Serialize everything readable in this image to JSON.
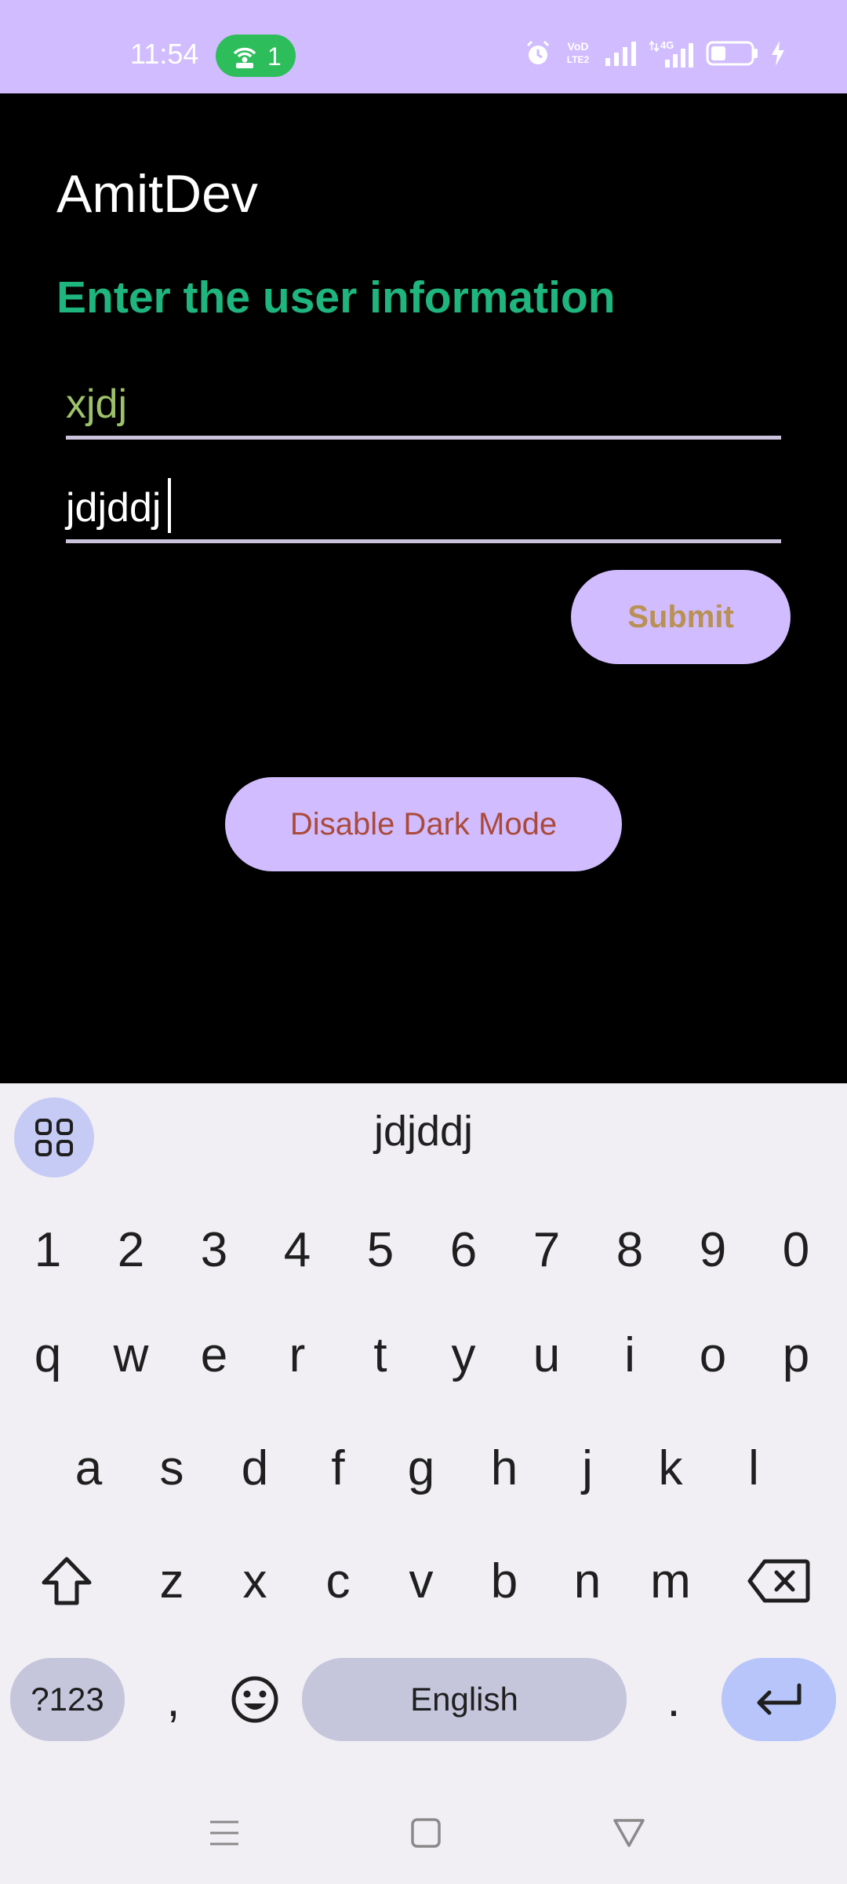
{
  "status_bar": {
    "time": "11:54",
    "hotspot_count": "1",
    "volte_label": "VoD LTE2",
    "network": "4G"
  },
  "app": {
    "title": "AmitDev",
    "prompt": "Enter the user information",
    "field1_value": "xjdj",
    "field2_value": "jdjddj",
    "submit_label": "Submit",
    "dark_mode_label": "Disable Dark Mode"
  },
  "keyboard": {
    "suggestion": "jdjddj",
    "numbers": [
      "1",
      "2",
      "3",
      "4",
      "5",
      "6",
      "7",
      "8",
      "9",
      "0"
    ],
    "row1": [
      "q",
      "w",
      "e",
      "r",
      "t",
      "y",
      "u",
      "i",
      "o",
      "p"
    ],
    "row2": [
      "a",
      "s",
      "d",
      "f",
      "g",
      "h",
      "j",
      "k",
      "l"
    ],
    "row3": [
      "z",
      "x",
      "c",
      "v",
      "b",
      "n",
      "m"
    ],
    "symbols_label": "?123",
    "comma_label": ",",
    "space_label": "English",
    "period_label": "."
  },
  "colors": {
    "accent": "#d0bcfe",
    "prompt_green": "#1fb57e",
    "submit_text": "#b99154",
    "dark_mode_text": "#ab4a3a"
  }
}
